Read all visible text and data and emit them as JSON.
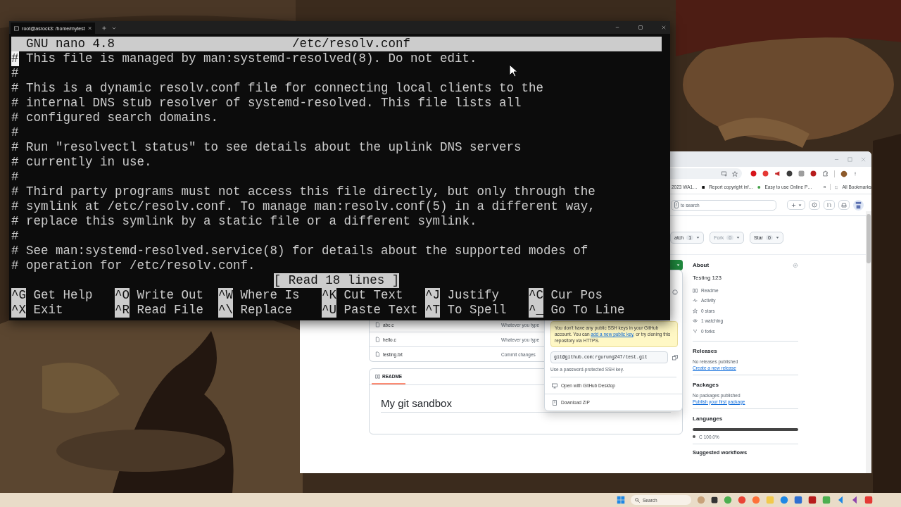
{
  "terminal": {
    "tab_title": "root@asrock3: /home/mytest",
    "nano": {
      "version": "GNU nano 4.8",
      "filename": "/etc/resolv.conf",
      "lines": [
        {
          "text": "# This file is managed by man:systemd-resolved(8). Do not edit.",
          "cursor": true
        },
        {
          "text": "#",
          "cursor": false
        },
        {
          "text": "# This is a dynamic resolv.conf file for connecting local clients to the",
          "cursor": false
        },
        {
          "text": "# internal DNS stub resolver of systemd-resolved. This file lists all",
          "cursor": false
        },
        {
          "text": "# configured search domains.",
          "cursor": false
        },
        {
          "text": "#",
          "cursor": false
        },
        {
          "text": "# Run \"resolvectl status\" to see details about the uplink DNS servers",
          "cursor": false
        },
        {
          "text": "# currently in use.",
          "cursor": false
        },
        {
          "text": "#",
          "cursor": false
        },
        {
          "text": "# Third party programs must not access this file directly, but only through the",
          "cursor": false
        },
        {
          "text": "# symlink at /etc/resolv.conf. To manage man:resolv.conf(5) in a different way,",
          "cursor": false
        },
        {
          "text": "# replace this symlink by a static file or a different symlink.",
          "cursor": false
        },
        {
          "text": "#",
          "cursor": false
        },
        {
          "text": "# See man:systemd-resolved.service(8) for details about the supported modes of",
          "cursor": false
        },
        {
          "text": "# operation for /etc/resolv.conf.",
          "cursor": false
        }
      ],
      "status": "[ Read 18 lines ]",
      "shortcuts": [
        {
          "key": "^G",
          "label": "Get Help"
        },
        {
          "key": "^O",
          "label": "Write Out"
        },
        {
          "key": "^W",
          "label": "Where Is"
        },
        {
          "key": "^K",
          "label": "Cut Text"
        },
        {
          "key": "^J",
          "label": "Justify"
        },
        {
          "key": "^C",
          "label": "Cur Pos"
        },
        {
          "key": "^X",
          "label": "Exit"
        },
        {
          "key": "^R",
          "label": "Read File"
        },
        {
          "key": "^\\",
          "label": "Replace"
        },
        {
          "key": "^U",
          "label": "Paste Text"
        },
        {
          "key": "^T",
          "label": "To Spell"
        },
        {
          "key": "^_",
          "label": "Go To Line"
        }
      ]
    }
  },
  "browser": {
    "bookmarks": [
      "2023 WA1…",
      "Report copyright inf…",
      "Easy to use Online P…"
    ],
    "bookmarks_more": "»",
    "all_bookmarks": "All Bookmarks",
    "search": {
      "key": "/",
      "placeholder": "to search"
    },
    "repo_actions": [
      {
        "label": "atch",
        "count": "1",
        "disabled": false
      },
      {
        "label": "Fork",
        "count": "0",
        "disabled": true
      },
      {
        "label": "Star",
        "count": "0",
        "disabled": false
      }
    ],
    "files": [
      {
        "name": "abc.c",
        "message": "Whatever you type"
      },
      {
        "name": "hello.c",
        "message": "Whatever you type"
      },
      {
        "name": "testing.txt",
        "message": "Commit changes"
      }
    ],
    "readme": {
      "tab": "README",
      "heading": "My git sandbox"
    },
    "clone_menu": {
      "notice_before": "You don't have any public SSH keys in your GitHub account. You can",
      "notice_link": "add a new public key",
      "notice_after": ", or try cloning this repository via HTTPS.",
      "url": "git@github.com:rgurung247/test.git",
      "hint": "Use a password-protected SSH key.",
      "actions": [
        {
          "kind": "desktop",
          "label": "Open with GitHub Desktop"
        },
        {
          "kind": "zip",
          "label": "Download ZIP"
        }
      ]
    },
    "about": {
      "title": "About",
      "description": "Testing 123",
      "stats": [
        {
          "kind": "readme",
          "label": "Readme"
        },
        {
          "kind": "activity",
          "label": "Activity"
        },
        {
          "kind": "stars",
          "label": "0 stars"
        },
        {
          "kind": "watching",
          "label": "1 watching"
        },
        {
          "kind": "forks",
          "label": "0 forks"
        }
      ]
    },
    "sections": [
      {
        "title": "Releases",
        "note": "No releases published",
        "link": "Create a new release"
      },
      {
        "title": "Packages",
        "note": "No packages published",
        "link": "Publish your first package"
      }
    ],
    "languages": {
      "title": "Languages",
      "items": [
        {
          "name": "C",
          "share": "100.0%",
          "color": "#555555",
          "level": 1
        }
      ]
    },
    "suggested": "Suggested workflows"
  },
  "taskbar": {
    "search": {
      "placeholder": "Search"
    }
  }
}
